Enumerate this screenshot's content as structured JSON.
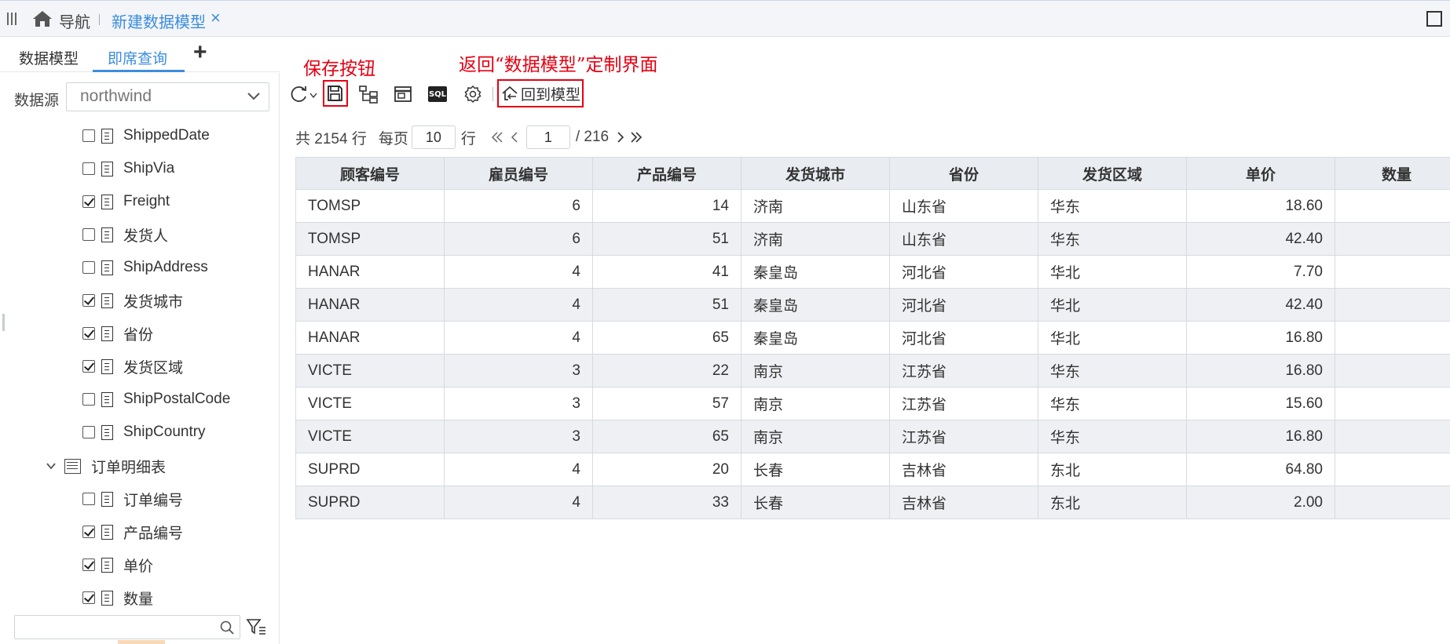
{
  "tabbar": {
    "nav_label": "导航",
    "active_tab": "新建数据模型",
    "close": "×"
  },
  "subtabs": [
    "数据模型",
    "即席查询"
  ],
  "add_tab": "+",
  "datasource": {
    "label": "数据源",
    "value": "northwind"
  },
  "tree": [
    {
      "label": "ShippedDate",
      "checked": false
    },
    {
      "label": "ShipVia",
      "checked": false
    },
    {
      "label": "Freight",
      "checked": true
    },
    {
      "label": "发货人",
      "checked": false
    },
    {
      "label": "ShipAddress",
      "checked": false
    },
    {
      "label": "发货城市",
      "checked": true
    },
    {
      "label": "省份",
      "checked": true
    },
    {
      "label": "发货区域",
      "checked": true
    },
    {
      "label": "ShipPostalCode",
      "checked": false
    },
    {
      "label": "ShipCountry",
      "checked": false
    }
  ],
  "tree_table": {
    "label": "订单明细表"
  },
  "tree2": [
    {
      "label": "订单编号",
      "checked": false
    },
    {
      "label": "产品编号",
      "checked": true
    },
    {
      "label": "单价",
      "checked": true
    },
    {
      "label": "数量",
      "checked": true
    }
  ],
  "search": {
    "placeholder": ""
  },
  "annotations": {
    "save": "保存按钮",
    "back": "返回“数据模型”定制界面"
  },
  "toolbar": {
    "back_label": "回到模型",
    "sql_label": "SQL"
  },
  "pager": {
    "total_text": "共 2154 行",
    "per_page_label": "每页",
    "per_page": "10",
    "rows_unit": "行",
    "page": "1",
    "total_pages": "/ 216"
  },
  "grid": {
    "columns": [
      "顾客编号",
      "雇员编号",
      "产品编号",
      "发货城市",
      "省份",
      "发货区域",
      "单价",
      "数量"
    ],
    "rows": [
      [
        "TOMSP",
        "6",
        "14",
        "济南",
        "山东省",
        "华东",
        "18.60",
        ""
      ],
      [
        "TOMSP",
        "6",
        "51",
        "济南",
        "山东省",
        "华东",
        "42.40",
        ""
      ],
      [
        "HANAR",
        "4",
        "41",
        "秦皇岛",
        "河北省",
        "华北",
        "7.70",
        ""
      ],
      [
        "HANAR",
        "4",
        "51",
        "秦皇岛",
        "河北省",
        "华北",
        "42.40",
        ""
      ],
      [
        "HANAR",
        "4",
        "65",
        "秦皇岛",
        "河北省",
        "华北",
        "16.80",
        ""
      ],
      [
        "VICTE",
        "3",
        "22",
        "南京",
        "江苏省",
        "华东",
        "16.80",
        ""
      ],
      [
        "VICTE",
        "3",
        "57",
        "南京",
        "江苏省",
        "华东",
        "15.60",
        ""
      ],
      [
        "VICTE",
        "3",
        "65",
        "南京",
        "江苏省",
        "华东",
        "16.80",
        ""
      ],
      [
        "SUPRD",
        "4",
        "20",
        "长春",
        "吉林省",
        "东北",
        "64.80",
        ""
      ],
      [
        "SUPRD",
        "4",
        "33",
        "长春",
        "吉林省",
        "东北",
        "2.00",
        ""
      ]
    ]
  },
  "colors": {
    "accent": "#3c8dde",
    "annotation": "#e60012"
  }
}
